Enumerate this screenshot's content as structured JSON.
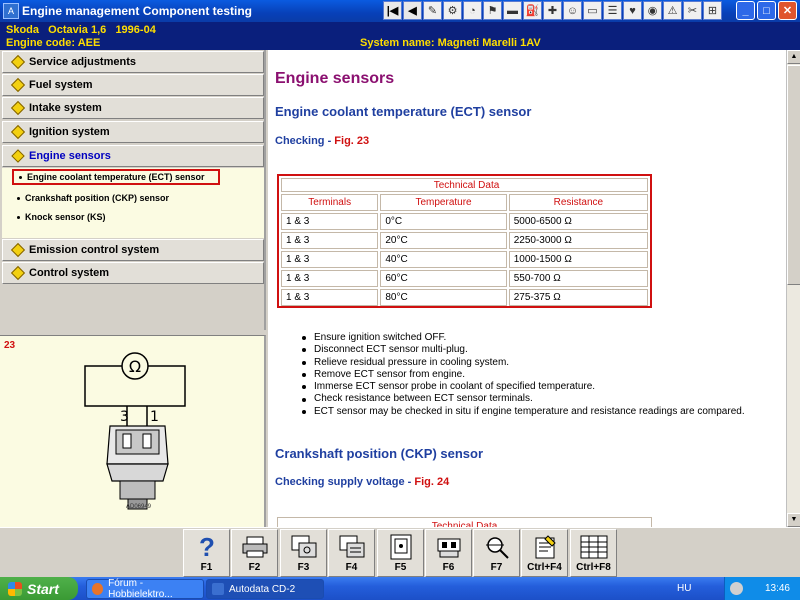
{
  "window": {
    "title": "Engine management Component testing",
    "toolbar_icons": [
      "first-page-icon",
      "prev-page-icon",
      "tool-icon-1",
      "tool-icon-2",
      "tool-icon-3",
      "tool-icon-4",
      "tool-icon-5",
      "tool-icon-6",
      "tool-icon-7",
      "tool-icon-8",
      "tool-icon-9",
      "tool-icon-10",
      "tool-icon-11",
      "tool-icon-12",
      "tool-icon-13",
      "tool-icon-14",
      "tool-icon-15"
    ],
    "minimize": "_",
    "maximize": "□",
    "close": "✕"
  },
  "vehicle": {
    "make_model": "Skoda   Octavia 1,6   1996-04",
    "engine_code": "Engine code: AEE",
    "system_name": "System name: Magneti Marelli 1AV"
  },
  "nav": {
    "items": [
      {
        "label": "Service adjustments"
      },
      {
        "label": "Fuel system"
      },
      {
        "label": "Intake system"
      },
      {
        "label": "Ignition system"
      },
      {
        "label": "Engine sensors"
      },
      {
        "label": "Emission control system"
      },
      {
        "label": "Control system"
      }
    ],
    "sub_items": [
      {
        "label": "Engine coolant temperature (ECT) sensor"
      },
      {
        "label": "Crankshaft position (CKP) sensor"
      },
      {
        "label": "Knock sensor (KS)"
      }
    ]
  },
  "figure": {
    "number": "23",
    "pin_left": "3",
    "pin_right": "1",
    "meter_symbol": "Ω",
    "code": "AD06949"
  },
  "content": {
    "heading": "Engine sensors",
    "section1_title": "Engine coolant temperature (ECT) sensor",
    "section1_checking": "Checking",
    "section1_sep": " - ",
    "section1_fig": "Fig. 23",
    "table": {
      "caption": "Technical Data",
      "headers": [
        "Terminals",
        "Temperature",
        "Resistance"
      ],
      "rows": [
        [
          "1 & 3",
          "0°C",
          "5000-6500 Ω"
        ],
        [
          "1 & 3",
          "20°C",
          "2250-3000 Ω"
        ],
        [
          "1 & 3",
          "40°C",
          "1000-1500 Ω"
        ],
        [
          "1 & 3",
          "60°C",
          "550-700 Ω"
        ],
        [
          "1 & 3",
          "80°C",
          "275-375 Ω"
        ]
      ]
    },
    "steps": [
      "Ensure ignition switched OFF.",
      "Disconnect ECT sensor multi-plug.",
      "Relieve residual pressure in cooling system.",
      "Remove ECT sensor from engine.",
      "Immerse ECT sensor probe in coolant of specified temperature.",
      "Check resistance between ECT sensor terminals.",
      "ECT sensor may be checked in situ if engine temperature and resistance readings are compared."
    ],
    "section2_title": "Crankshaft position (CKP) sensor",
    "section2_checking": "Checking supply voltage",
    "section2_sep": " - ",
    "section2_fig": "Fig. 24",
    "table2_caption": "Technical Data"
  },
  "fkeys": [
    {
      "label": "F1",
      "icon": "help-icon"
    },
    {
      "label": "F2",
      "icon": "print-icon"
    },
    {
      "label": "F3",
      "icon": "component-icon"
    },
    {
      "label": "F4",
      "icon": "wiring-icon"
    },
    {
      "label": "F5",
      "icon": "pinout-icon"
    },
    {
      "label": "F6",
      "icon": "connector-icon"
    },
    {
      "label": "F7",
      "icon": "probe-icon"
    },
    {
      "label": "Ctrl+F4",
      "icon": "notes-icon"
    },
    {
      "label": "Ctrl+F8",
      "icon": "table-icon"
    }
  ],
  "taskbar": {
    "start_label": "Start",
    "tasks": [
      {
        "label": "Fórum - Hobbielektro..."
      },
      {
        "label": "Autodata CD-2"
      }
    ],
    "language": "HU",
    "clock": "13:46"
  },
  "colors": {
    "title_bar": "#0840b8",
    "vehicle_header": "#0a1f7c",
    "vehicle_text": "#ffde00",
    "heading": "#8b1070",
    "section_title": "#1f3fa0",
    "highlight_red": "#d01010"
  }
}
